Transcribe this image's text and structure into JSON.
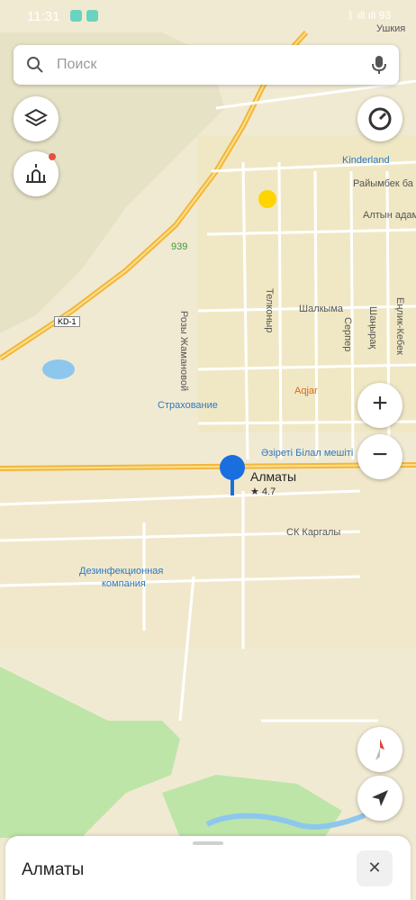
{
  "status_bar": {
    "time": "11:31",
    "right": "ᛒ ıll ıll 93"
  },
  "search": {
    "placeholder": "Поиск"
  },
  "top_right_label": "Ушкия",
  "map_labels": {
    "kinderland": "Kinderland",
    "raiymbek": "Райымбек ба",
    "altyn": "Алтын адам",
    "stop_939": "939",
    "kd1": "KD-1",
    "rozy": "Розы Жамановой",
    "telkonyr": "Телконыр",
    "shalkyma": "Шалкыма",
    "serper": "Серпер",
    "shanyrak": "Шаңырақ",
    "enlik": "Еңлик-Кебек",
    "aqjar": "Aqjar",
    "strakhovanie": "Страхование",
    "mosque": "Әзіреті Білал мешіті",
    "almaty_pin": "Алматы",
    "rating": "★ 4.7",
    "kargaly": "СК Каргалы",
    "dezinf_1": "Дезинфекционная",
    "dezinf_2": "компания"
  },
  "controls": {
    "zoom_in": "+",
    "zoom_out": "−"
  },
  "bottom_sheet": {
    "title": "Алматы",
    "close": "✕"
  },
  "colors": {
    "accent": "#2c79c4",
    "pin": "#1a6fe0",
    "highway": "#f3b63c",
    "water": "#8ec7ee",
    "forest": "#bde5a8"
  }
}
